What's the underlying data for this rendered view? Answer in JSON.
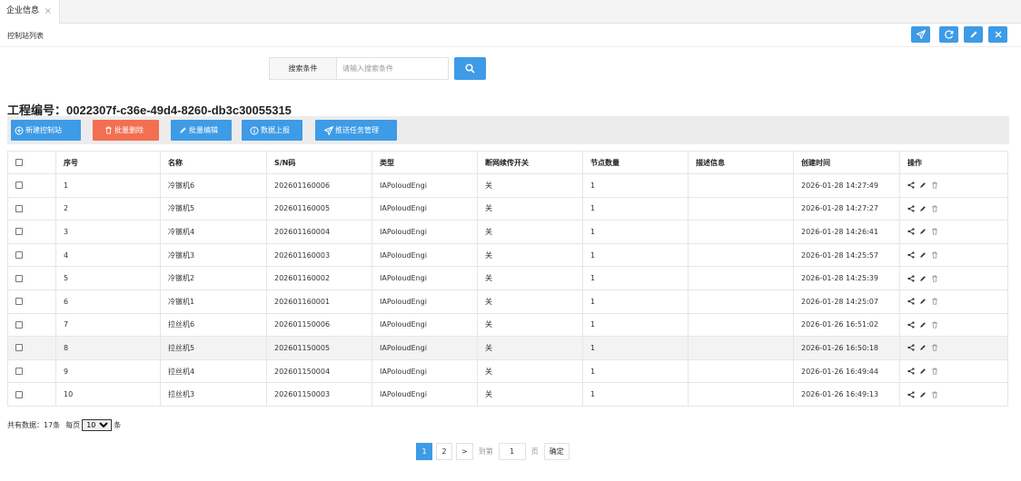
{
  "tab": {
    "label": "企业信息",
    "close": "×"
  },
  "breadcrumb": "控制站列表",
  "search": {
    "label": "搜索条件",
    "placeholder": "请输入搜索条件"
  },
  "page_title": "工程编号：0022307f-c36e-49d4-8260-db3c30055315",
  "actions": {
    "new": "新建控制站",
    "batch_delete": "批量删除",
    "batch_edit": "批量编辑",
    "data_report": "数据上报",
    "push_tasks": "推送任务管理"
  },
  "columns": [
    "序号",
    "名称",
    "S/N码",
    "类型",
    "断网续传开关",
    "节点数量",
    "描述信息",
    "创建时间",
    "操作"
  ],
  "rows": [
    {
      "no": "1",
      "name": "冷镦机6",
      "sn": "202601160006",
      "type": "IAPoloudEngi",
      "resume": "关",
      "nodes": "1",
      "desc": "",
      "created": "2026-01-28 14:27:49"
    },
    {
      "no": "2",
      "name": "冷镦机5",
      "sn": "202601160005",
      "type": "IAPoloudEngi",
      "resume": "关",
      "nodes": "1",
      "desc": "",
      "created": "2026-01-28 14:27:27"
    },
    {
      "no": "3",
      "name": "冷镦机4",
      "sn": "202601160004",
      "type": "IAPoloudEngi",
      "resume": "关",
      "nodes": "1",
      "desc": "",
      "created": "2026-01-28 14:26:41"
    },
    {
      "no": "4",
      "name": "冷镦机3",
      "sn": "202601160003",
      "type": "IAPoloudEngi",
      "resume": "关",
      "nodes": "1",
      "desc": "",
      "created": "2026-01-28 14:25:57"
    },
    {
      "no": "5",
      "name": "冷镦机2",
      "sn": "202601160002",
      "type": "IAPoloudEngi",
      "resume": "关",
      "nodes": "1",
      "desc": "",
      "created": "2026-01-28 14:25:39"
    },
    {
      "no": "6",
      "name": "冷镦机1",
      "sn": "202601160001",
      "type": "IAPoloudEngi",
      "resume": "关",
      "nodes": "1",
      "desc": "",
      "created": "2026-01-28 14:25:07"
    },
    {
      "no": "7",
      "name": "拉丝机6",
      "sn": "202601150006",
      "type": "IAPoloudEngi",
      "resume": "关",
      "nodes": "1",
      "desc": "",
      "created": "2026-01-26 16:51:02"
    },
    {
      "no": "8",
      "name": "拉丝机5",
      "sn": "202601150005",
      "type": "IAPoloudEngi",
      "resume": "关",
      "nodes": "1",
      "desc": "",
      "created": "2026-01-26 16:50:18"
    },
    {
      "no": "9",
      "name": "拉丝机4",
      "sn": "202601150004",
      "type": "IAPoloudEngi",
      "resume": "关",
      "nodes": "1",
      "desc": "",
      "created": "2026-01-26 16:49:44"
    },
    {
      "no": "10",
      "name": "拉丝机3",
      "sn": "202601150003",
      "type": "IAPoloudEngi",
      "resume": "关",
      "nodes": "1",
      "desc": "",
      "created": "2026-01-26 16:49:13"
    }
  ],
  "footer": {
    "total": "共有数据：17条",
    "per_page_prefix": "每页",
    "per_page": "10",
    "per_page_suffix": "条"
  },
  "pagination": {
    "pages": [
      "1",
      "2"
    ],
    "next": ">",
    "goto_prefix": "到第",
    "current": "1",
    "goto_suffix": "页",
    "confirm": "确定"
  },
  "colors": {
    "primary": "#3e9be6",
    "danger": "#f26f52"
  }
}
